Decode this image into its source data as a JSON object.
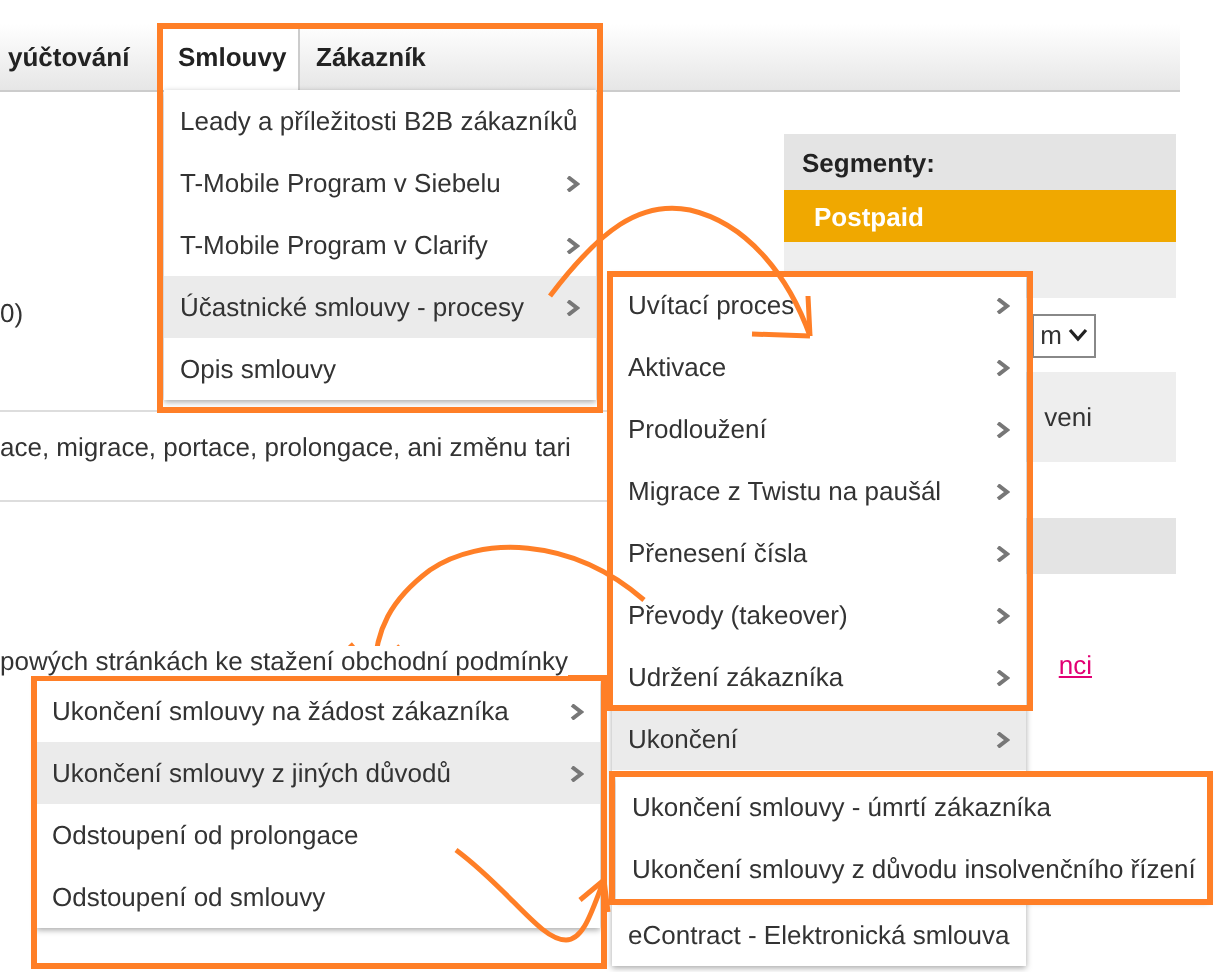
{
  "nav_tabs": [
    {
      "label": "yúčtování",
      "selected": false
    },
    {
      "label": "Smlouvy",
      "selected": true
    },
    {
      "label": "Zákazník",
      "selected": false
    }
  ],
  "content_lines": [
    "0)",
    "ace, migrace, portace, prolongace, ani změnu tari",
    "powých stránkách ke stažení obchodní podmínky"
  ],
  "segments_panel": {
    "title": "Segmenty:",
    "items": [
      {
        "label": "Postpaid",
        "selected": true
      }
    ],
    "select_value": "m",
    "row_text": "veni"
  },
  "link": "nci",
  "menus": [
    {
      "items": [
        {
          "label": "Leady a příležitosti B2B zákazníků",
          "submenu": false,
          "highlighted": false
        },
        {
          "label": "T-Mobile Program v Siebelu",
          "submenu": true,
          "highlighted": false
        },
        {
          "label": "T-Mobile Program v Clarify",
          "submenu": true,
          "highlighted": false
        },
        {
          "label": "Účastnické smlouvy - procesy",
          "submenu": true,
          "highlighted": true
        },
        {
          "label": "Opis smlouvy",
          "submenu": false,
          "highlighted": false
        }
      ]
    },
    {
      "items": [
        {
          "label": "Uvítací proces",
          "submenu": true,
          "highlighted": false
        },
        {
          "label": "Aktivace",
          "submenu": true,
          "highlighted": false
        },
        {
          "label": "Prodloužení",
          "submenu": true,
          "highlighted": false
        },
        {
          "label": "Migrace z Twistu na paušál",
          "submenu": true,
          "highlighted": false
        },
        {
          "label": "Přenesení čísla",
          "submenu": true,
          "highlighted": false
        },
        {
          "label": "Převody (takeover)",
          "submenu": true,
          "highlighted": false
        },
        {
          "label": "Udržení zákazníka",
          "submenu": true,
          "highlighted": false
        },
        {
          "label": "Ukončení",
          "submenu": true,
          "highlighted": true
        },
        {
          "label": "eContract - Elektronická smlouva",
          "submenu": false,
          "highlighted": false
        }
      ]
    },
    {
      "items": [
        {
          "label": "Ukončení smlouvy na žádost zákazníka",
          "submenu": true,
          "highlighted": false
        },
        {
          "label": "Ukončení smlouvy z jiných důvodů",
          "submenu": true,
          "highlighted": true
        },
        {
          "label": "Odstoupení od prolongace",
          "submenu": false,
          "highlighted": false
        },
        {
          "label": "Odstoupení od smlouvy",
          "submenu": false,
          "highlighted": false
        }
      ]
    },
    {
      "items": [
        {
          "label": "Ukončení smlouvy - úmrtí zákazníka",
          "submenu": false,
          "highlighted": false
        },
        {
          "label": "Ukončení smlouvy z důvodu insolvenčního řízení",
          "submenu": false,
          "highlighted": false
        }
      ]
    }
  ]
}
